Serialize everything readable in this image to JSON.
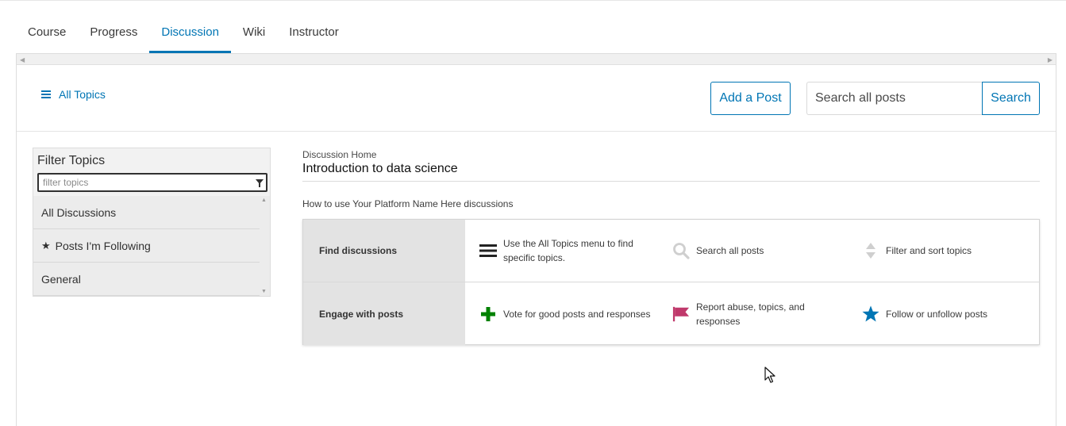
{
  "tabs": [
    {
      "label": "Course"
    },
    {
      "label": "Progress"
    },
    {
      "label": "Discussion",
      "active": true
    },
    {
      "label": "Wiki"
    },
    {
      "label": "Instructor"
    }
  ],
  "header": {
    "all_topics_label": "All Topics",
    "add_post_label": "Add a Post",
    "search_placeholder": "Search all posts",
    "search_button_label": "Search"
  },
  "sidebar": {
    "title": "Filter Topics",
    "filter_placeholder": "filter topics",
    "topics": [
      {
        "label": "All Discussions"
      },
      {
        "label": "Posts I'm Following",
        "icon": "star-icon"
      },
      {
        "label": "General"
      }
    ]
  },
  "main": {
    "breadcrumb": "Discussion Home",
    "course_title": "Introduction to data science",
    "howto_label": "How to use Your Platform Name Here discussions",
    "guide": {
      "rows": [
        {
          "label": "Find discussions",
          "items": [
            {
              "icon": "menu-icon",
              "text": "Use the All Topics menu to find specific topics."
            },
            {
              "icon": "search-icon",
              "text": "Search all posts"
            },
            {
              "icon": "sort-icon",
              "text": "Filter and sort topics"
            }
          ]
        },
        {
          "label": "Engage with posts",
          "items": [
            {
              "icon": "plus-icon",
              "text": "Vote for good posts and responses"
            },
            {
              "icon": "flag-icon",
              "text": "Report abuse, topics, and responses"
            },
            {
              "icon": "star-icon",
              "text": "Follow or unfollow posts"
            }
          ]
        }
      ]
    }
  },
  "colors": {
    "accent": "#0075b4",
    "plus": "#008100",
    "flag": "#c0396b",
    "star": "#0075b4"
  }
}
